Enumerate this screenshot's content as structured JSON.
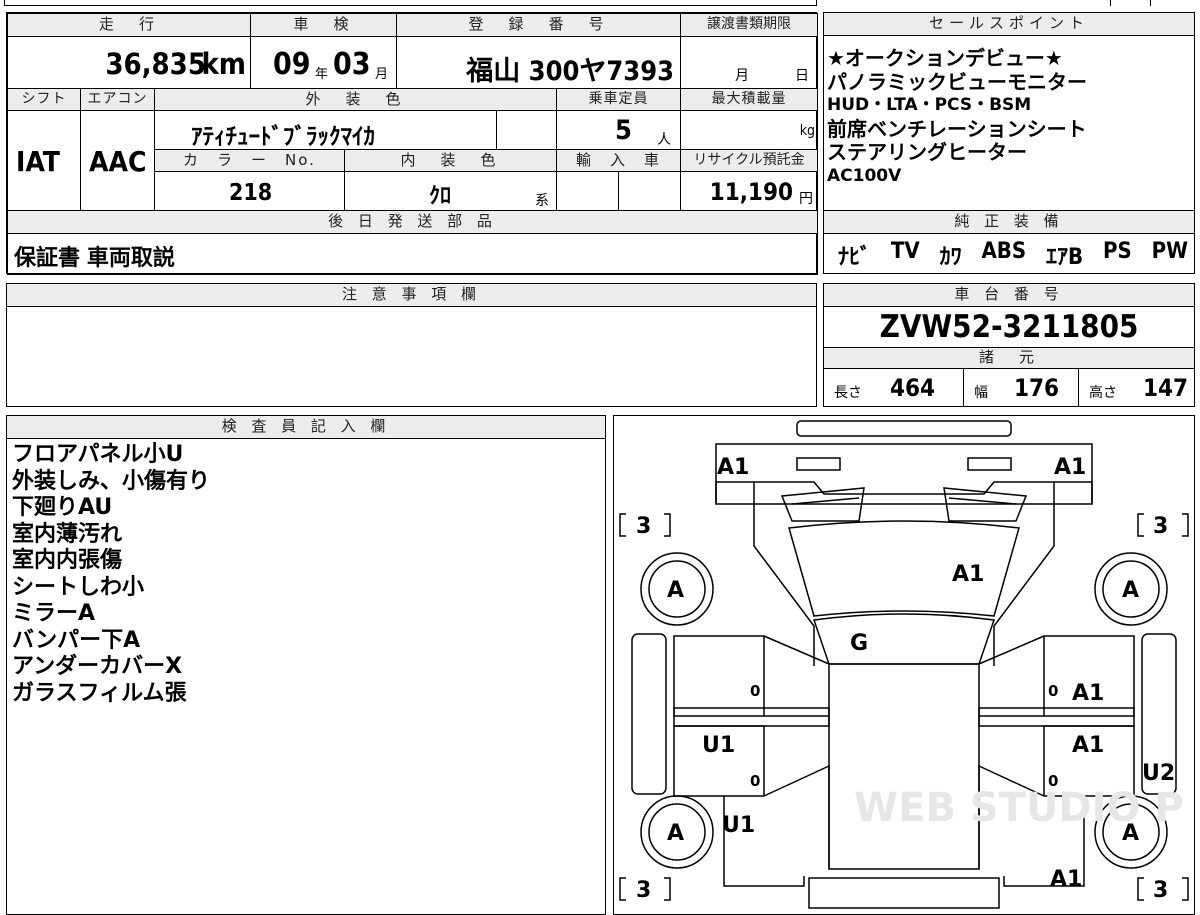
{
  "vehicle": {
    "mileage_header": "走　行",
    "mileage_value": "36,835",
    "mileage_unit": "km",
    "shaken_header": "車　検",
    "shaken_year": "09",
    "shaken_year_unit": "年",
    "shaken_month": "03",
    "shaken_month_unit": "月",
    "reg_header": "登　録　番　号",
    "reg_value": "福山 300ヤ7393",
    "transfer_header": "譲渡書類期限",
    "transfer_month": "月",
    "transfer_day": "日",
    "shift_header": "シフト",
    "shift_value": "IAT",
    "ac_header": "エアコン",
    "ac_value": "AAC",
    "exterior_header": "外　装　色",
    "exterior_value": "ｱﾃｨﾁｭｰﾄﾞﾌﾞﾗｯｸﾏｲｶ",
    "capacity_header": "乗車定員",
    "capacity_value": "5",
    "capacity_unit": "人",
    "load_header": "最大積載量",
    "load_unit": "kg",
    "color_no_header": "カ　ラ　ー　No.",
    "color_no_value": "218",
    "interior_header": "内　装　色",
    "interior_value": "ｸﾛ",
    "interior_suffix": "系",
    "import_header": "輸　入　車",
    "recycle_header": "リサイクル預託金",
    "recycle_value": "11,190",
    "recycle_unit": "円"
  },
  "later_parts": {
    "header": "後 日 発 送 部 品",
    "value": "保証書 車両取説"
  },
  "caution": {
    "header": "注 意 事 項 欄"
  },
  "sales_points": {
    "header": "セールスポイント",
    "lines": [
      "★オークションデビュー★",
      "パノラミックビューモニター",
      "HUD・LTA・PCS・BSM",
      "前席ベンチレーションシート",
      "ステアリングヒーター",
      "AC100V"
    ]
  },
  "equipment": {
    "header": "純 正 装 備",
    "items": [
      "ﾅﾋﾞ",
      "TV",
      "ｶﾜ",
      "ABS",
      "ｴｱB",
      "PS",
      "PW"
    ]
  },
  "chassis": {
    "header": "車 台 番 号",
    "value": "ZVW52-3211805"
  },
  "dimensions": {
    "header": "諸　元",
    "length_label": "長さ",
    "length_value": "464",
    "width_label": "幅",
    "width_value": "176",
    "height_label": "高さ",
    "height_value": "147"
  },
  "inspector": {
    "header": "検 査 員 記 入 欄",
    "notes": [
      "フロアパネル小U",
      "外装しみ、小傷有り",
      "下廻りAU",
      "室内薄汚れ",
      "室内内張傷",
      "シートしわ小",
      "ミラーA",
      "バンパー下A",
      "アンダーカバーX",
      "ガラスフィルム張"
    ]
  },
  "diagram": {
    "front_left": "A1",
    "front_right": "A1",
    "tire_rating_tl": "3",
    "tire_rating_tr": "3",
    "tire_rating_bl": "3",
    "tire_rating_br": "3",
    "wheel_fl": "A",
    "wheel_fr": "A",
    "wheel_rl": "A",
    "wheel_rr": "A",
    "hood": "A1",
    "windshield": "G",
    "front_door_right": "A1",
    "rear_door_left": "U1",
    "rear_door_right": "A1",
    "rear_left": "U1",
    "quarter_right": "U2",
    "rear_right": "A1",
    "door_zero_1": "0",
    "door_zero_2": "0",
    "door_zero_3": "0",
    "door_zero_4": "0",
    "watermark": "WEB STUDIO P"
  }
}
